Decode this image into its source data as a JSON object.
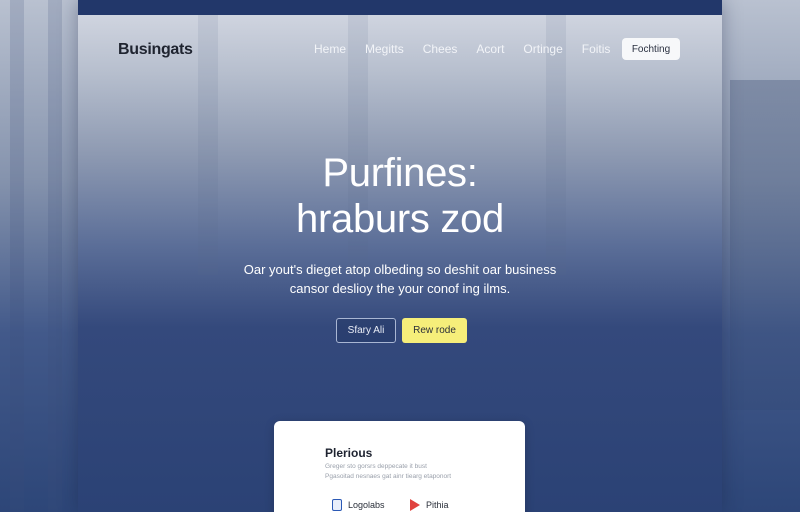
{
  "nav": {
    "brand": "Busingats",
    "links": [
      "Heme",
      "Megitts",
      "Chees",
      "Acort",
      "Ortinge",
      "Foitis"
    ],
    "cta": "Fochting"
  },
  "hero": {
    "title_line1": "Purfines:",
    "title_line2": "hraburs zod",
    "subtitle_line1": "Oar yout's dieget atop olbeding so deshit oar business",
    "subtitle_line2": "cansor deslioy the your conof ing ilms.",
    "button_outline": "Sfary Ali",
    "button_primary": "Rew rode"
  },
  "card": {
    "title": "Plerious",
    "text_line1": "Greger sto gorsrs deppecate it bust",
    "text_line2": "Pgasoitad nesnaes gat ainr tiearg etaponort",
    "store_a": "Logolabs",
    "store_b": "Pithia"
  },
  "colors": {
    "accent_yellow": "#f6ee7a",
    "navy": "#22376a"
  }
}
